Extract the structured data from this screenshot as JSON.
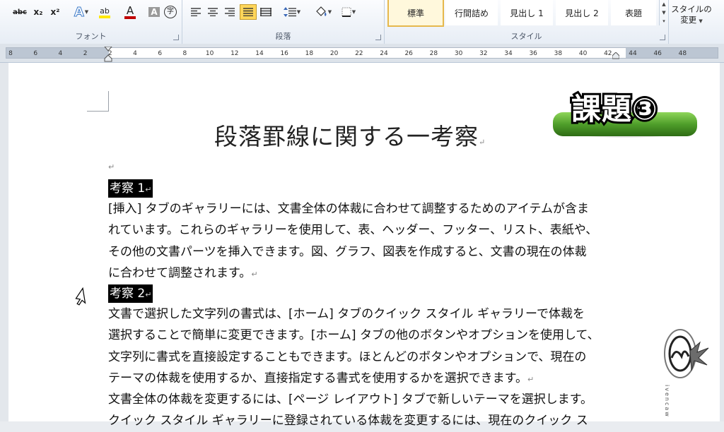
{
  "ribbon": {
    "font_group_label": "フォント",
    "paragraph_group_label": "段落",
    "styles_group_label": "スタイル",
    "font_buttons": [
      "abc",
      "x₂",
      "x²",
      "A",
      "ab",
      "A",
      "A",
      "字"
    ],
    "styles": [
      {
        "label": "標準",
        "selected": true
      },
      {
        "label": "行間詰め",
        "selected": false
      },
      {
        "label": "見出し 1",
        "selected": false
      },
      {
        "label": "見出し 2",
        "selected": false
      },
      {
        "label": "表題",
        "selected": false
      }
    ],
    "change_styles_label": "スタイルの変更"
  },
  "ruler": {
    "numbers": [
      "8",
      "6",
      "4",
      "2",
      "2",
      "4",
      "6",
      "8",
      "10",
      "12",
      "14",
      "16",
      "18",
      "20",
      "22",
      "24",
      "26",
      "28",
      "30",
      "32",
      "34",
      "36",
      "38",
      "40",
      "42",
      "44",
      "46",
      "48"
    ]
  },
  "document": {
    "title": "段落罫線に関する一考察",
    "badge": "課題③",
    "sections": [
      {
        "heading": "考察 1",
        "paragraphs": [
          [
            "[挿入] タブのギャラリーには、文書全体の体裁に合わせて調整するためのアイテムが含ま",
            "れています。これらのギャラリーを使用して、表、ヘッダー、フッター、リスト、表紙や、",
            "その他の文書パーツを挿入できます。図、グラフ、図表を作成すると、文書の現在の体裁",
            "に合わせて調整されます。"
          ]
        ]
      },
      {
        "heading": "考察 2",
        "paragraphs": [
          [
            "文書で選択した文字列の書式は、[ホーム] タブのクイック スタイル ギャラリーで体裁を",
            "選択することで簡単に変更できます。[ホーム] タブの他のボタンやオプションを使用して、",
            "文字列に書式を直接設定することもできます。ほとんどのボタンやオプションで、現在の",
            "テーマの体裁を使用するか、直接指定する書式を使用するかを選択できます。"
          ],
          [
            "文書全体の体裁を変更するには、[ページ レイアウト] タブで新しいテーマを選択します。",
            "クイック スタイル ギャラリーに登録されている体裁を変更するには、現在のクイック ス"
          ]
        ]
      }
    ],
    "paragraph_mark": "↵"
  },
  "logo_text": "ivencaw",
  "colors": {
    "ribbon_bg": "#e7edf5",
    "badge_green": "#5aa832",
    "heading_bg": "#000000",
    "selected_style": "#e6b84c"
  }
}
